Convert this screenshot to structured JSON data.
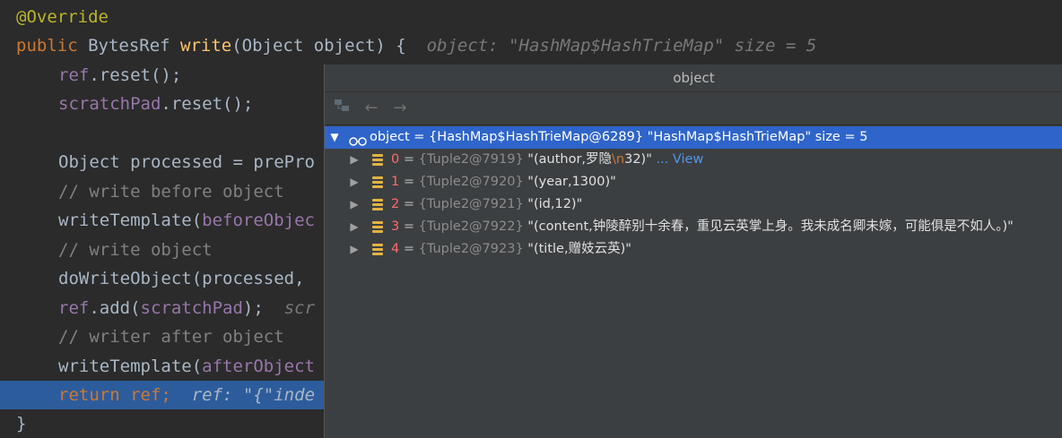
{
  "code": {
    "lines": [
      {
        "t1": "@Override"
      },
      {
        "kw": "public ",
        "type": "BytesRef ",
        "mth": "write",
        "rest": "(Object object) {  ",
        "hint": "object: \"HashMap$HashTrieMap\" size = 5"
      },
      {
        "fld": "ref",
        "rest": ".reset();"
      },
      {
        "fld": "scratchPad",
        "rest": ".reset();"
      },
      {
        "rest": ""
      },
      {
        "rest": "Object processed = prePro"
      },
      {
        "cmt": "// write before object"
      },
      {
        "rest": "writeTemplate(",
        "fld": "beforeObjec"
      },
      {
        "cmt": "// write object"
      },
      {
        "rest": "doWriteObject(processed, "
      },
      {
        "fld": "ref",
        "rest": ".add(",
        "fld2": "scratchPad",
        "rest2": ");  ",
        "hint": "scr"
      },
      {
        "cmt": "// writer after object"
      },
      {
        "rest": "writeTemplate(",
        "fld": "afterObject"
      },
      {
        "kw": "return ",
        "fld": "ref",
        "rest": ";  ",
        "hint": "ref: \"{\"inde"
      },
      {
        "rest": "}"
      }
    ]
  },
  "popup": {
    "title": "object",
    "toolbar": {
      "left_arrow": "←",
      "right_arrow": "→"
    },
    "root": {
      "name": "object",
      "eq": " = ",
      "type": "{HashMap$HashTrieMap@6289}",
      "value": " \"HashMap$HashTrieMap\" size = 5"
    },
    "items": [
      {
        "index": "0",
        "eq": " = ",
        "type": "{Tuple2@7919}",
        "value_a": " \"(author,罗隐",
        "esc": "\\n",
        "value_b": "32)\"",
        "view": " ... View"
      },
      {
        "index": "1",
        "eq": " = ",
        "type": "{Tuple2@7920}",
        "value_a": " \"(year,1300)\""
      },
      {
        "index": "2",
        "eq": " = ",
        "type": "{Tuple2@7921}",
        "value_a": " \"(id,12)\""
      },
      {
        "index": "3",
        "eq": " = ",
        "type": "{Tuple2@7922}",
        "value_a": " \"(content,钟陵醉别十余春，重见云英掌上身。我未成名卿未嫁，可能俱是不如人。)\""
      },
      {
        "index": "4",
        "eq": " = ",
        "type": "{Tuple2@7923}",
        "value_a": " \"(title,赠妓云英)\""
      }
    ]
  }
}
